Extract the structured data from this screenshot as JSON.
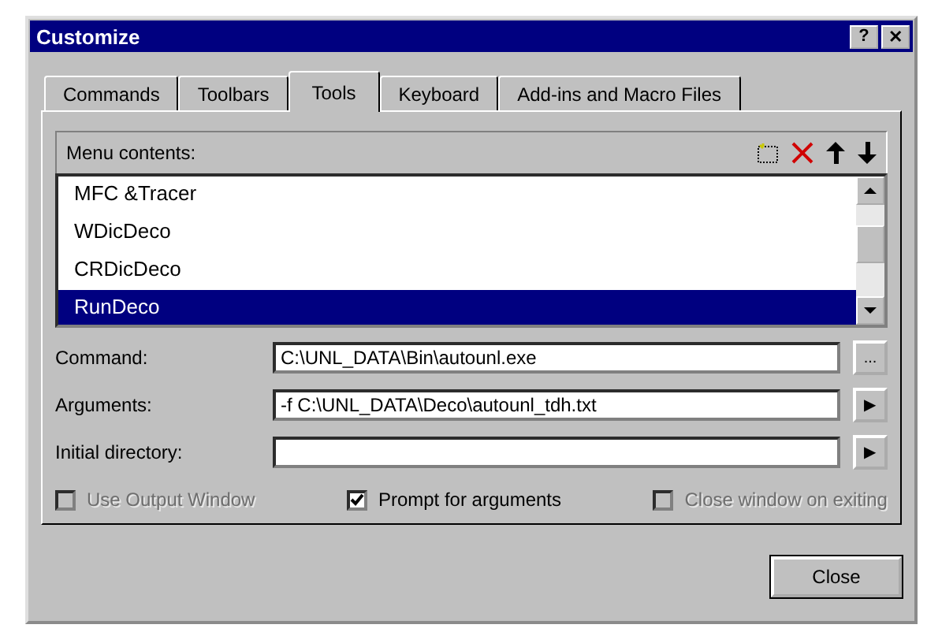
{
  "window": {
    "title": "Customize",
    "help_button": "?",
    "close_button": "✕"
  },
  "tabs": [
    {
      "label": "Commands",
      "selected": false
    },
    {
      "label": "Toolbars",
      "selected": false
    },
    {
      "label": "Tools",
      "selected": true
    },
    {
      "label": "Keyboard",
      "selected": false
    },
    {
      "label": "Add-ins and Macro Files",
      "selected": false
    }
  ],
  "menu_contents": {
    "label": "Menu contents:",
    "items": [
      {
        "label": "MFC &Tracer",
        "selected": false
      },
      {
        "label": "WDicDeco",
        "selected": false
      },
      {
        "label": "CRDicDeco",
        "selected": false
      },
      {
        "label": "RunDeco",
        "selected": true
      }
    ]
  },
  "fields": [
    {
      "label": "Command:",
      "value": "C:\\UNL_DATA\\Bin\\autounl.exe",
      "button": "..."
    },
    {
      "label": "Arguments:",
      "value": "-f C:\\UNL_DATA\\Deco\\autounl_tdh.txt",
      "button": "▶"
    },
    {
      "label": "Initial directory:",
      "button": "▶"
    }
  ],
  "options": [
    {
      "label": "Use Output Window",
      "checked": false,
      "disabled": true
    },
    {
      "label": "Prompt for arguments",
      "checked": true,
      "disabled": false
    },
    {
      "label": "Close window on exiting",
      "checked": false,
      "disabled": true
    }
  ],
  "buttons": [
    "Close"
  ]
}
